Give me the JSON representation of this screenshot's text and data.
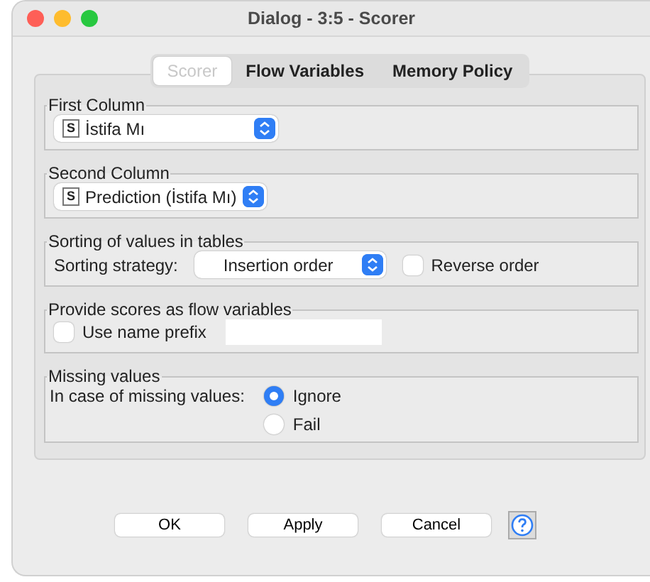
{
  "window": {
    "title": "Dialog - 3:5 - Scorer"
  },
  "tabs": [
    {
      "label": "Scorer",
      "selected": true
    },
    {
      "label": "Flow Variables",
      "selected": false
    },
    {
      "label": "Memory Policy",
      "selected": false
    }
  ],
  "first_column": {
    "legend": "First Column",
    "type_badge": "S",
    "value": "İstifa Mı"
  },
  "second_column": {
    "legend": "Second Column",
    "type_badge": "S",
    "value": "Prediction (İstifa Mı)"
  },
  "sorting": {
    "legend": "Sorting of values in tables",
    "label": "Sorting strategy:",
    "value": "Insertion order",
    "reverse_order": {
      "label": "Reverse order",
      "checked": false
    }
  },
  "flow_variables": {
    "legend": "Provide scores as flow variables",
    "use_name_prefix": {
      "label": "Use name prefix",
      "checked": false
    }
  },
  "missing_values": {
    "legend": "Missing values",
    "label": "In case of missing values:",
    "options": [
      {
        "label": "Ignore",
        "selected": true
      },
      {
        "label": "Fail",
        "selected": false
      }
    ]
  },
  "buttons": [
    "OK",
    "Apply",
    "Cancel"
  ]
}
